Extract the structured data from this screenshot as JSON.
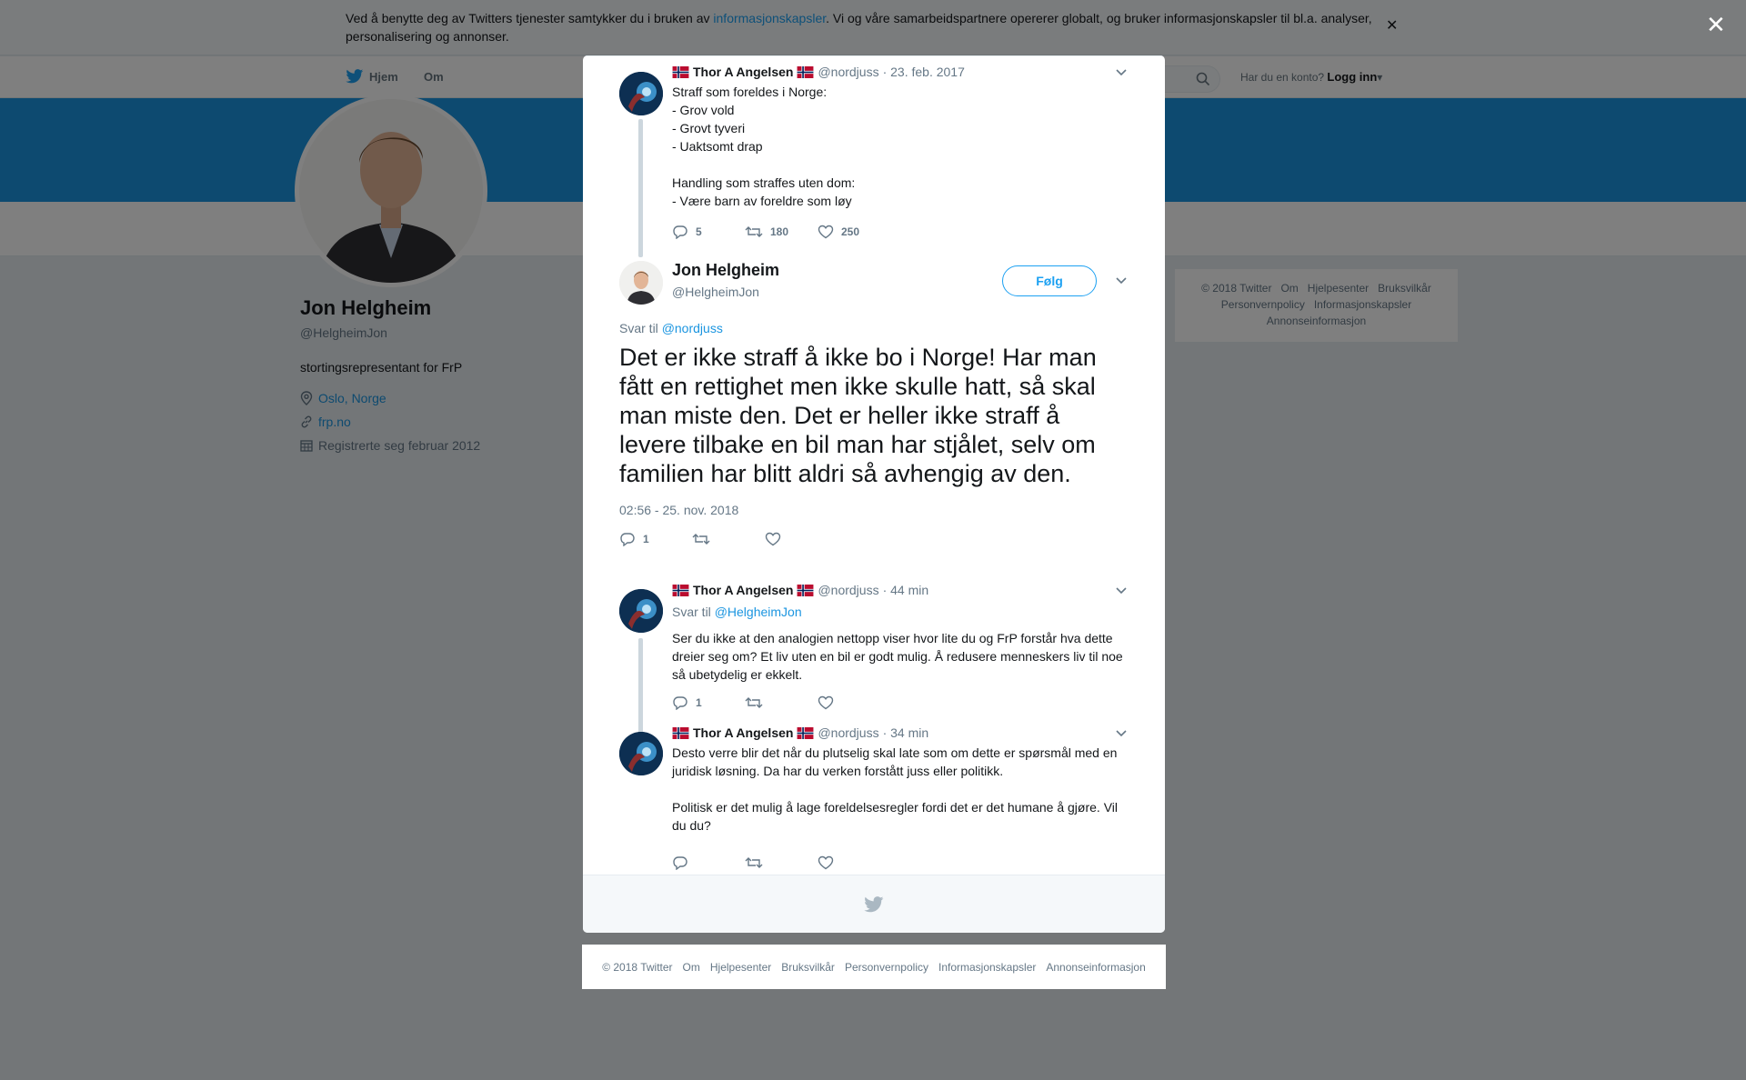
{
  "cookie_banner": {
    "text_before": "Ved å benytte deg av Twitters tjenester samtykker du i bruken av ",
    "link": "informasjonskapsler",
    "text_after": ". Vi og våre samarbeidspartnere opererer globalt, og bruker informasjonskapsler til bl.a. analyser, personalisering og annonser."
  },
  "nav": {
    "home": "Hjem",
    "about": "Om",
    "account_prompt": "Har du en konto?",
    "login": "Logg inn"
  },
  "profile": {
    "name": "Jon Helgheim",
    "handle": "@HelgheimJon",
    "bio": "stortingsrepresentant for FrP",
    "location": "Oslo, Norge",
    "website": "frp.no",
    "joined": "Registrerte seg februar 2012"
  },
  "side_footer": {
    "links": [
      "© 2018 Twitter",
      "Om",
      "Hjelpesenter",
      "Bruksvilkår",
      "Personvernpolicy",
      "Informasjonskapsler",
      "Annonseinformasjon"
    ]
  },
  "thread": {
    "parent": {
      "name": "Thor A Angelsen",
      "handle": "@nordjuss",
      "time": "· 23. feb. 2017",
      "text": "Straff som foreldes i Norge:\n- Grov vold\n- Grovt tyveri\n- Uaktsomt drap\n\nHandling som straffes uten dom:\n- Være barn av foreldre som løy",
      "replies": "5",
      "retweets": "180",
      "likes": "250"
    },
    "main": {
      "name": "Jon Helgheim",
      "handle": "@HelgheimJon",
      "follow_label": "Følg",
      "reply_prefix": "Svar til ",
      "reply_to": "@nordjuss",
      "text": "Det er ikke straff å ikke bo i Norge! Har man fått en rettighet men ikke skulle hatt, så skal man miste den. Det er heller ikke straff å levere tilbake en bil man har stjålet, selv om familien har blitt aldri så avhengig av den.",
      "timestamp": "02:56 - 25. nov. 2018",
      "replies": "1"
    },
    "reply1": {
      "name": "Thor A Angelsen",
      "handle": "@nordjuss",
      "time": "· 44 min",
      "reply_prefix": "Svar til ",
      "reply_to": "@HelgheimJon",
      "text": "Ser du ikke at den analogien nettopp viser hvor lite du og FrP forstår hva dette dreier seg om? Et liv uten en bil er godt mulig. Å redusere menneskers liv til noe så ubetydelig er ekkelt.",
      "replies": "1"
    },
    "reply2": {
      "name": "Thor A Angelsen",
      "handle": "@nordjuss",
      "time": "· 34 min",
      "text": "Desto verre blir det når du plutselig skal late som om dette er spørsmål med en juridisk løsning. Da har du verken forstått juss eller politikk.\n\nPolitisk er det mulig å lage foreldelsesregler fordi det er det humane å gjøre. Vil du du?"
    }
  },
  "bottom_footer": {
    "links": [
      "© 2018 Twitter",
      "Om",
      "Hjelpesenter",
      "Bruksvilkår",
      "Personvernpolicy",
      "Informasjonskapsler",
      "Annonseinformasjon"
    ]
  },
  "colors": {
    "accent": "#1da1f2",
    "banner": "#1b95e0",
    "muted": "#657786",
    "text": "#14171a"
  },
  "icons": [
    "twitter-bird-icon",
    "search-icon",
    "location-icon",
    "link-icon",
    "calendar-icon",
    "reply-icon",
    "retweet-icon",
    "like-icon",
    "chevron-down-icon",
    "close-icon",
    "norway-flag-icon"
  ]
}
